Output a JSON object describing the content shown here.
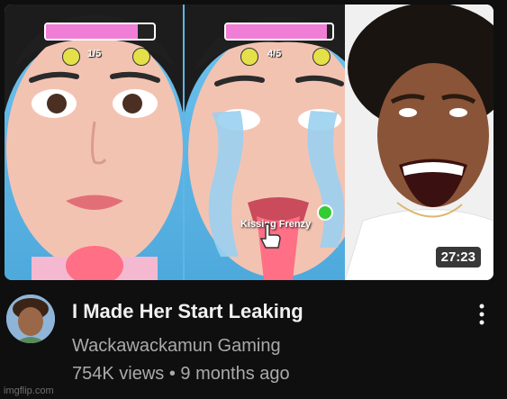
{
  "video": {
    "duration": "27:23",
    "title": "I Made Her Start Leaking",
    "channel": "Wackawackamun Gaming",
    "views": "754K views",
    "separator": "•",
    "age": "9 months ago"
  },
  "thumbnail": {
    "left_counter": "1/5",
    "right_counter": "4/5",
    "left_progress": 0.85,
    "right_progress": 0.95,
    "overlay_label": "Kissing Frenzy"
  },
  "watermark": "imgflip.com",
  "colors": {
    "background": "#0f0f0f",
    "progress_fill": "#f17ed6",
    "sky": "#5fb6e6"
  }
}
